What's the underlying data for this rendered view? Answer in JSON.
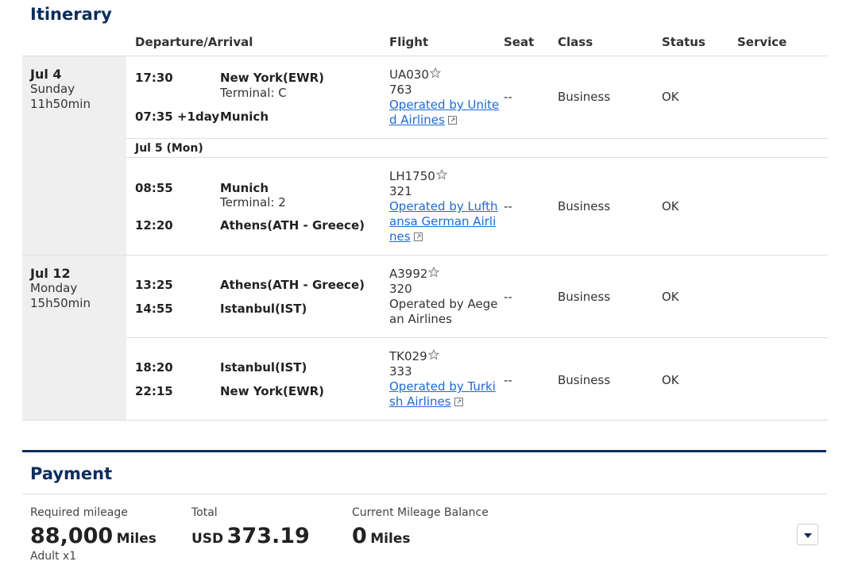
{
  "itinerary": {
    "title": "Itinerary",
    "headers": {
      "departure_arrival": "Departure/Arrival",
      "flight": "Flight",
      "seat": "Seat",
      "class": "Class",
      "status": "Status",
      "service": "Service"
    },
    "days": [
      {
        "date": "Jul 4",
        "weekday": "Sunday",
        "duration": "11h50min"
      },
      {
        "date": "Jul 12",
        "weekday": "Monday",
        "duration": "15h50min"
      }
    ],
    "sub_date": "Jul 5 (Mon)",
    "segments": [
      {
        "dep_time": "17:30",
        "dep_city": "New York(EWR)",
        "dep_terminal": "Terminal: C",
        "arr_time": "07:35 +1day",
        "arr_city": "Munich",
        "arr_terminal": "",
        "flight_no": "UA030",
        "aircraft": "763",
        "operated_by": "Operated by United Airlines",
        "operated_link": true,
        "seat": "--",
        "class": "Business",
        "status": "OK",
        "service": ""
      },
      {
        "dep_time": "08:55",
        "dep_city": "Munich",
        "dep_terminal": "Terminal: 2",
        "arr_time": "12:20",
        "arr_city": "Athens(ATH - Greece)",
        "arr_terminal": "",
        "flight_no": "LH1750",
        "aircraft": "321",
        "operated_by": "Operated by Lufthansa German Airlines",
        "operated_link": true,
        "seat": "--",
        "class": "Business",
        "status": "OK",
        "service": ""
      },
      {
        "dep_time": "13:25",
        "dep_city": "Athens(ATH - Greece)",
        "dep_terminal": "",
        "arr_time": "14:55",
        "arr_city": "Istanbul(IST)",
        "arr_terminal": "",
        "flight_no": "A3992",
        "aircraft": "320",
        "operated_by": "Operated by Aegean Airlines",
        "operated_link": false,
        "seat": "--",
        "class": "Business",
        "status": "OK",
        "service": ""
      },
      {
        "dep_time": "18:20",
        "dep_city": "Istanbul(IST)",
        "dep_terminal": "",
        "arr_time": "22:15",
        "arr_city": "New York(EWR)",
        "arr_terminal": "",
        "flight_no": "TK029",
        "aircraft": "333",
        "operated_by": "Operated by Turkish Airlines",
        "operated_link": true,
        "seat": "--",
        "class": "Business",
        "status": "OK",
        "service": ""
      }
    ]
  },
  "payment": {
    "title": "Payment",
    "required_mileage": {
      "label": "Required mileage",
      "value": "88,000",
      "unit": "Miles",
      "sub": "Adult x1"
    },
    "total": {
      "label": "Total",
      "currency": "USD",
      "value": "373.19"
    },
    "balance": {
      "label": "Current Mileage Balance",
      "value": "0",
      "unit": "Miles"
    },
    "expand_icon": "chevron-down-icon"
  },
  "colors": {
    "brand_navy": "#0c2d5f",
    "link_blue": "#1a6adb",
    "day_bg": "#efefef"
  }
}
